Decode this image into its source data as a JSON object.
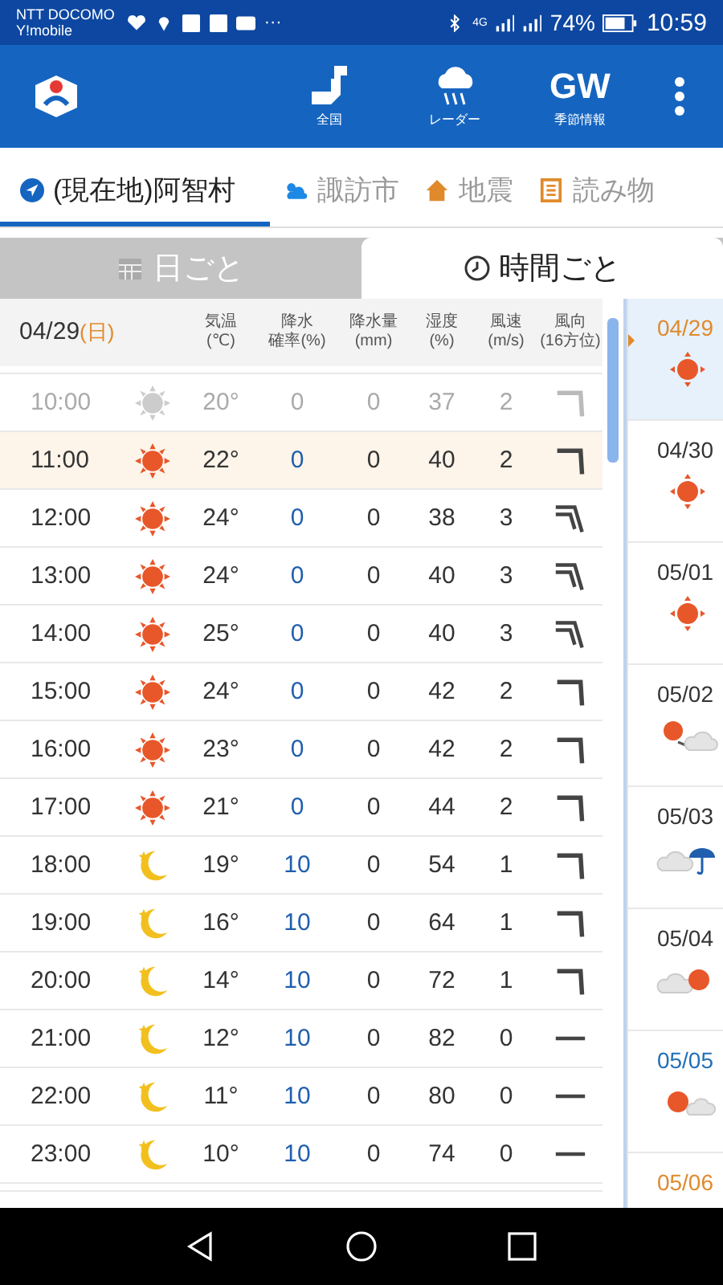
{
  "status_bar": {
    "carrier": "NTT DOCOMO",
    "carrier_2": "Y!mobile",
    "more": "···",
    "network": "4G",
    "battery": "74%",
    "time": "10:59"
  },
  "app_bar": {
    "actions": [
      {
        "kind": "map",
        "label": "全国"
      },
      {
        "kind": "radar",
        "label": "レーダー"
      },
      {
        "kind": "text",
        "mark": "GW",
        "label": "季節情報"
      }
    ]
  },
  "tabs": [
    {
      "kind": "location",
      "label": "(現在地)阿智村",
      "selected": true
    },
    {
      "kind": "weather",
      "label": "諏訪市",
      "selected": false
    },
    {
      "kind": "quake",
      "label": "地震",
      "selected": false
    },
    {
      "kind": "article",
      "label": "読み物",
      "selected": false
    }
  ],
  "view_tabs": [
    {
      "kind": "calendar",
      "label": "日ごと",
      "selected": false
    },
    {
      "kind": "clock",
      "label": "時間ごと",
      "selected": true
    }
  ],
  "table": {
    "date": "04/29",
    "weekday": "(日)",
    "columns": [
      {
        "line1": "気温",
        "line2": "(℃)"
      },
      {
        "line1": "降水",
        "line2": "確率(%)"
      },
      {
        "line1": "降水量",
        "line2": "(mm)"
      },
      {
        "line1": "湿度",
        "line2": "(%)"
      },
      {
        "line1": "風速",
        "line2": "(m/s)"
      },
      {
        "line1": "風向",
        "line2": "(16方位)"
      }
    ],
    "rows": [
      {
        "time": "10:00",
        "weather": {
          "kind": "sun"
        },
        "temp": "20°",
        "pop": "0",
        "rain": "0",
        "humidity": "37",
        "speed": "2",
        "wind": {
          "kind": "single"
        },
        "past": true,
        "current": false
      },
      {
        "time": "11:00",
        "weather": {
          "kind": "sun"
        },
        "temp": "22°",
        "pop": "0",
        "rain": "0",
        "humidity": "40",
        "speed": "2",
        "wind": {
          "kind": "single"
        },
        "past": false,
        "current": true
      },
      {
        "time": "12:00",
        "weather": {
          "kind": "sun"
        },
        "temp": "24°",
        "pop": "0",
        "rain": "0",
        "humidity": "38",
        "speed": "3",
        "wind": {
          "kind": "double"
        },
        "past": false,
        "current": false
      },
      {
        "time": "13:00",
        "weather": {
          "kind": "sun"
        },
        "temp": "24°",
        "pop": "0",
        "rain": "0",
        "humidity": "40",
        "speed": "3",
        "wind": {
          "kind": "double"
        },
        "past": false,
        "current": false
      },
      {
        "time": "14:00",
        "weather": {
          "kind": "sun"
        },
        "temp": "25°",
        "pop": "0",
        "rain": "0",
        "humidity": "40",
        "speed": "3",
        "wind": {
          "kind": "double"
        },
        "past": false,
        "current": false
      },
      {
        "time": "15:00",
        "weather": {
          "kind": "sun"
        },
        "temp": "24°",
        "pop": "0",
        "rain": "0",
        "humidity": "42",
        "speed": "2",
        "wind": {
          "kind": "single"
        },
        "past": false,
        "current": false
      },
      {
        "time": "16:00",
        "weather": {
          "kind": "sun"
        },
        "temp": "23°",
        "pop": "0",
        "rain": "0",
        "humidity": "42",
        "speed": "2",
        "wind": {
          "kind": "single"
        },
        "past": false,
        "current": false
      },
      {
        "time": "17:00",
        "weather": {
          "kind": "sun"
        },
        "temp": "21°",
        "pop": "0",
        "rain": "0",
        "humidity": "44",
        "speed": "2",
        "wind": {
          "kind": "single"
        },
        "past": false,
        "current": false
      },
      {
        "time": "18:00",
        "weather": {
          "kind": "moon"
        },
        "temp": "19°",
        "pop": "10",
        "rain": "0",
        "humidity": "54",
        "speed": "1",
        "wind": {
          "kind": "single"
        },
        "past": false,
        "current": false
      },
      {
        "time": "19:00",
        "weather": {
          "kind": "moon"
        },
        "temp": "16°",
        "pop": "10",
        "rain": "0",
        "humidity": "64",
        "speed": "1",
        "wind": {
          "kind": "single"
        },
        "past": false,
        "current": false
      },
      {
        "time": "20:00",
        "weather": {
          "kind": "moon"
        },
        "temp": "14°",
        "pop": "10",
        "rain": "0",
        "humidity": "72",
        "speed": "1",
        "wind": {
          "kind": "single"
        },
        "past": false,
        "current": false
      },
      {
        "time": "21:00",
        "weather": {
          "kind": "moon"
        },
        "temp": "12°",
        "pop": "10",
        "rain": "0",
        "humidity": "82",
        "speed": "0",
        "wind": {
          "kind": "calm"
        },
        "past": false,
        "current": false
      },
      {
        "time": "22:00",
        "weather": {
          "kind": "moon"
        },
        "temp": "11°",
        "pop": "10",
        "rain": "0",
        "humidity": "80",
        "speed": "0",
        "wind": {
          "kind": "calm"
        },
        "past": false,
        "current": false
      },
      {
        "time": "23:00",
        "weather": {
          "kind": "moon"
        },
        "temp": "10°",
        "pop": "10",
        "rain": "0",
        "humidity": "74",
        "speed": "0",
        "wind": {
          "kind": "calm"
        },
        "past": false,
        "current": false
      }
    ]
  },
  "days": [
    {
      "date": "04/29",
      "color": "#e08a2c",
      "weather": {
        "kind": "sun"
      },
      "selected": true
    },
    {
      "date": "04/30",
      "color": "#333333",
      "weather": {
        "kind": "sun"
      },
      "selected": false
    },
    {
      "date": "05/01",
      "color": "#333333",
      "weather": {
        "kind": "sun"
      },
      "selected": false
    },
    {
      "date": "05/02",
      "color": "#333333",
      "weather": {
        "kind": "sun-then-cloud"
      },
      "selected": false
    },
    {
      "date": "05/03",
      "color": "#333333",
      "weather": {
        "kind": "cloud-rain"
      },
      "selected": false
    },
    {
      "date": "05/04",
      "color": "#333333",
      "weather": {
        "kind": "cloud-sun"
      },
      "selected": false
    },
    {
      "date": "05/05",
      "color": "#1f6fb5",
      "weather": {
        "kind": "sun-cloud"
      },
      "selected": false
    },
    {
      "date": "05/06",
      "color": "#e08a2c",
      "selected": false
    }
  ]
}
